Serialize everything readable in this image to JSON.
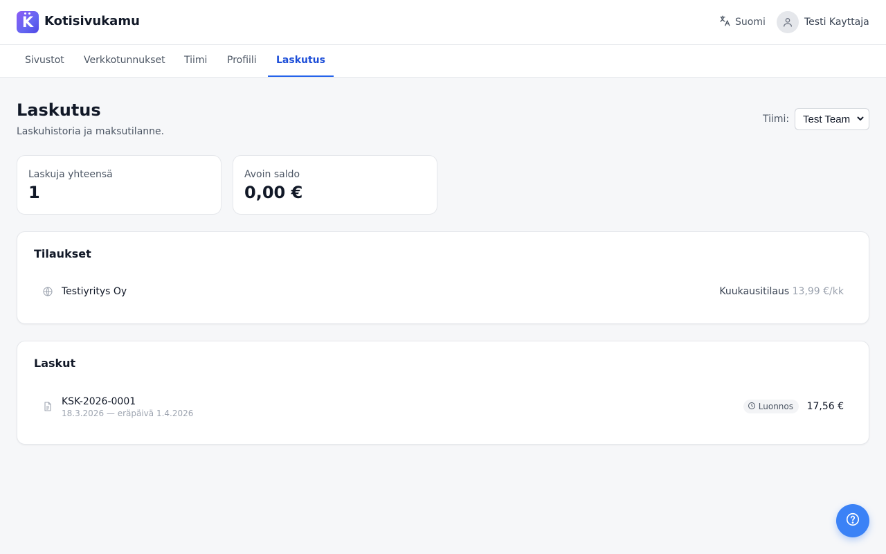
{
  "app": {
    "brand": "Kotisivukamu",
    "logo_letter": "K",
    "accent_color": "#2563eb",
    "logo_gradient": [
      "#8b5cf6",
      "#4f46e5"
    ]
  },
  "header": {
    "language": {
      "label": "Suomi",
      "icon": "translate-icon"
    },
    "user": {
      "name": "Testi Kayttaja",
      "icon": "user-icon"
    }
  },
  "tabs": [
    {
      "label": "Sivustot",
      "active": false
    },
    {
      "label": "Verkkotunnukset",
      "active": false
    },
    {
      "label": "Tiimi",
      "active": false
    },
    {
      "label": "Profiili",
      "active": false
    },
    {
      "label": "Laskutus",
      "active": true
    }
  ],
  "page": {
    "title": "Laskutus",
    "subtitle": "Laskuhistoria ja maksutilanne.",
    "team_label": "Tiimi:",
    "team_selected": "Test Team"
  },
  "stats": [
    {
      "label": "Laskuja yhteensä",
      "value": "1"
    },
    {
      "label": "Avoin saldo",
      "value": "0,00 €"
    }
  ],
  "subscriptions": {
    "title": "Tilaukset",
    "items": [
      {
        "icon": "globe-icon",
        "name": "Testiyritys Oy",
        "plan": "Kuukausitilaus",
        "price": "13,99 €/kk"
      }
    ]
  },
  "invoices": {
    "title": "Laskut",
    "items": [
      {
        "icon": "document-icon",
        "number": "KSK-2026-0001",
        "dates": "18.3.2026 — eräpäivä 1.4.2026",
        "status": "Luonnos",
        "status_icon": "clock-icon",
        "amount": "17,56 €"
      }
    ]
  },
  "help": {
    "icon": "help-circle-icon"
  }
}
